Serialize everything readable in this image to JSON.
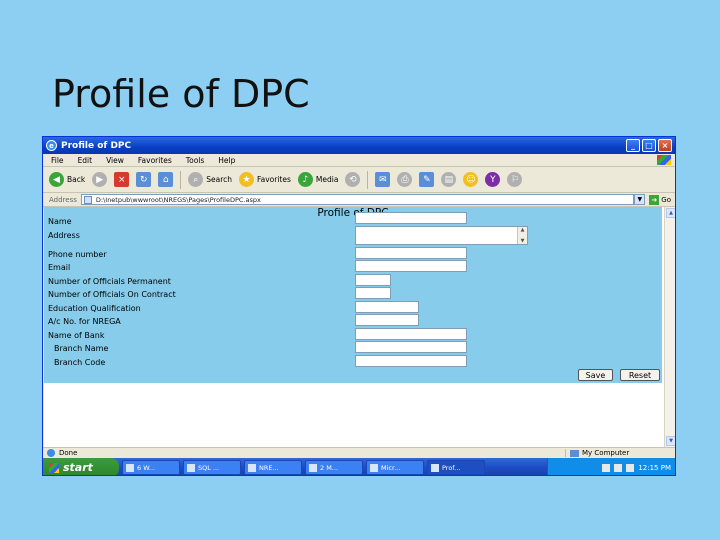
{
  "slide": {
    "title": "Profile of DPC"
  },
  "window": {
    "title": "Profile of DPC",
    "menu": [
      "File",
      "Edit",
      "View",
      "Favorites",
      "Tools",
      "Help"
    ],
    "toolbar": {
      "back": "Back",
      "search": "Search",
      "favorites": "Favorites",
      "media": "Media"
    },
    "address": {
      "label": "Address",
      "url": "D:\\Inetpub\\wwwroot\\NREGS\\Pages\\ProfileDPC.aspx",
      "go": "Go"
    }
  },
  "form": {
    "title": "Profile of DPC",
    "fields": [
      {
        "label": "Name"
      },
      {
        "label": "Address"
      },
      {
        "label": "Phone number"
      },
      {
        "label": "Email"
      },
      {
        "label": "Number of Officials Permanent"
      },
      {
        "label": "Number of Officials On Contract"
      },
      {
        "label": "Education Qualification"
      },
      {
        "label": "A/c No. for NREGA"
      },
      {
        "label": "Name of Bank"
      },
      {
        "label": "Branch Name"
      },
      {
        "label": "Branch Code"
      }
    ],
    "save": "Save",
    "reset": "Reset"
  },
  "status": {
    "text": "Done",
    "zone": "My Computer"
  },
  "taskbar": {
    "start": "start",
    "tasks": [
      "6 W...",
      "SQL ...",
      "NRE...",
      "2 M...",
      "Micr...",
      "Prof..."
    ],
    "clock": "12:15 PM"
  }
}
